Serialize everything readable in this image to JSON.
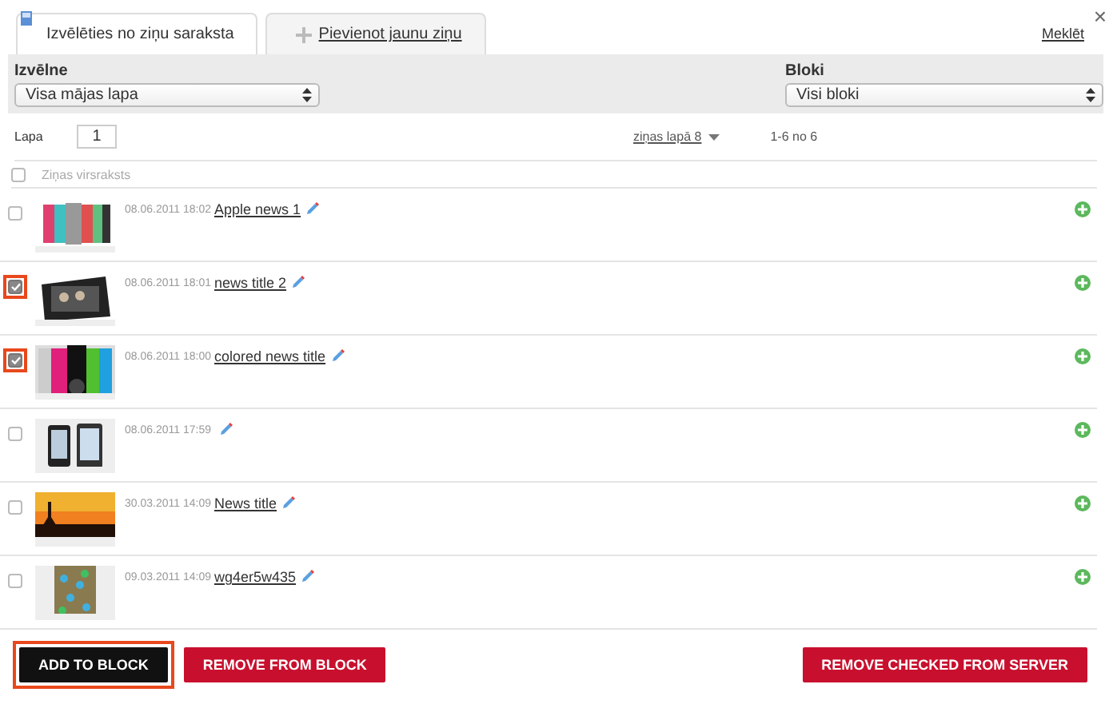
{
  "tabs": [
    {
      "label": "Izvēlēties no ziņu saraksta",
      "kind": "list",
      "selected": true
    },
    {
      "label": "Pievienot jaunu ziņu",
      "kind": "add",
      "selected": false
    }
  ],
  "search_link": "Meklēt",
  "close": "×",
  "filters": [
    {
      "label": "Izvēlne",
      "value": "Visa mājas lapa"
    },
    {
      "label": "Bloki",
      "value": "Visi bloki"
    }
  ],
  "pager": {
    "label": "Lapa",
    "page": "1",
    "per_page": "ziņas lapā 8",
    "range": "1-6 no 6"
  },
  "table": {
    "header": "Ziņas virsraksts",
    "header_checked": false,
    "rows": [
      {
        "date": "08.06.2011 18:02",
        "title": "Apple news 1",
        "checked": false,
        "highlighted": false
      },
      {
        "date": "08.06.2011 18:01",
        "title": "news title 2",
        "checked": true,
        "highlighted": true
      },
      {
        "date": "08.06.2011 18:00",
        "title": "colored news title",
        "checked": true,
        "highlighted": true
      },
      {
        "date": "08.06.2011 17:59",
        "checked": false,
        "highlighted": false
      },
      {
        "date": "30.03.2011 14:09",
        "title": "News title",
        "checked": false,
        "highlighted": false
      },
      {
        "date": "09.03.2011 14:09",
        "title": "wg4er5w435",
        "checked": false,
        "highlighted": false
      }
    ]
  },
  "buttons": [
    {
      "label": "ADD TO BLOCK",
      "kind": "dark",
      "highlighted": true
    },
    {
      "label": "REMOVE FROM BLOCK",
      "kind": "red",
      "highlighted": false
    },
    {
      "label": "REMOVE CHECKED FROM SERVER",
      "kind": "red",
      "highlighted": false
    }
  ]
}
